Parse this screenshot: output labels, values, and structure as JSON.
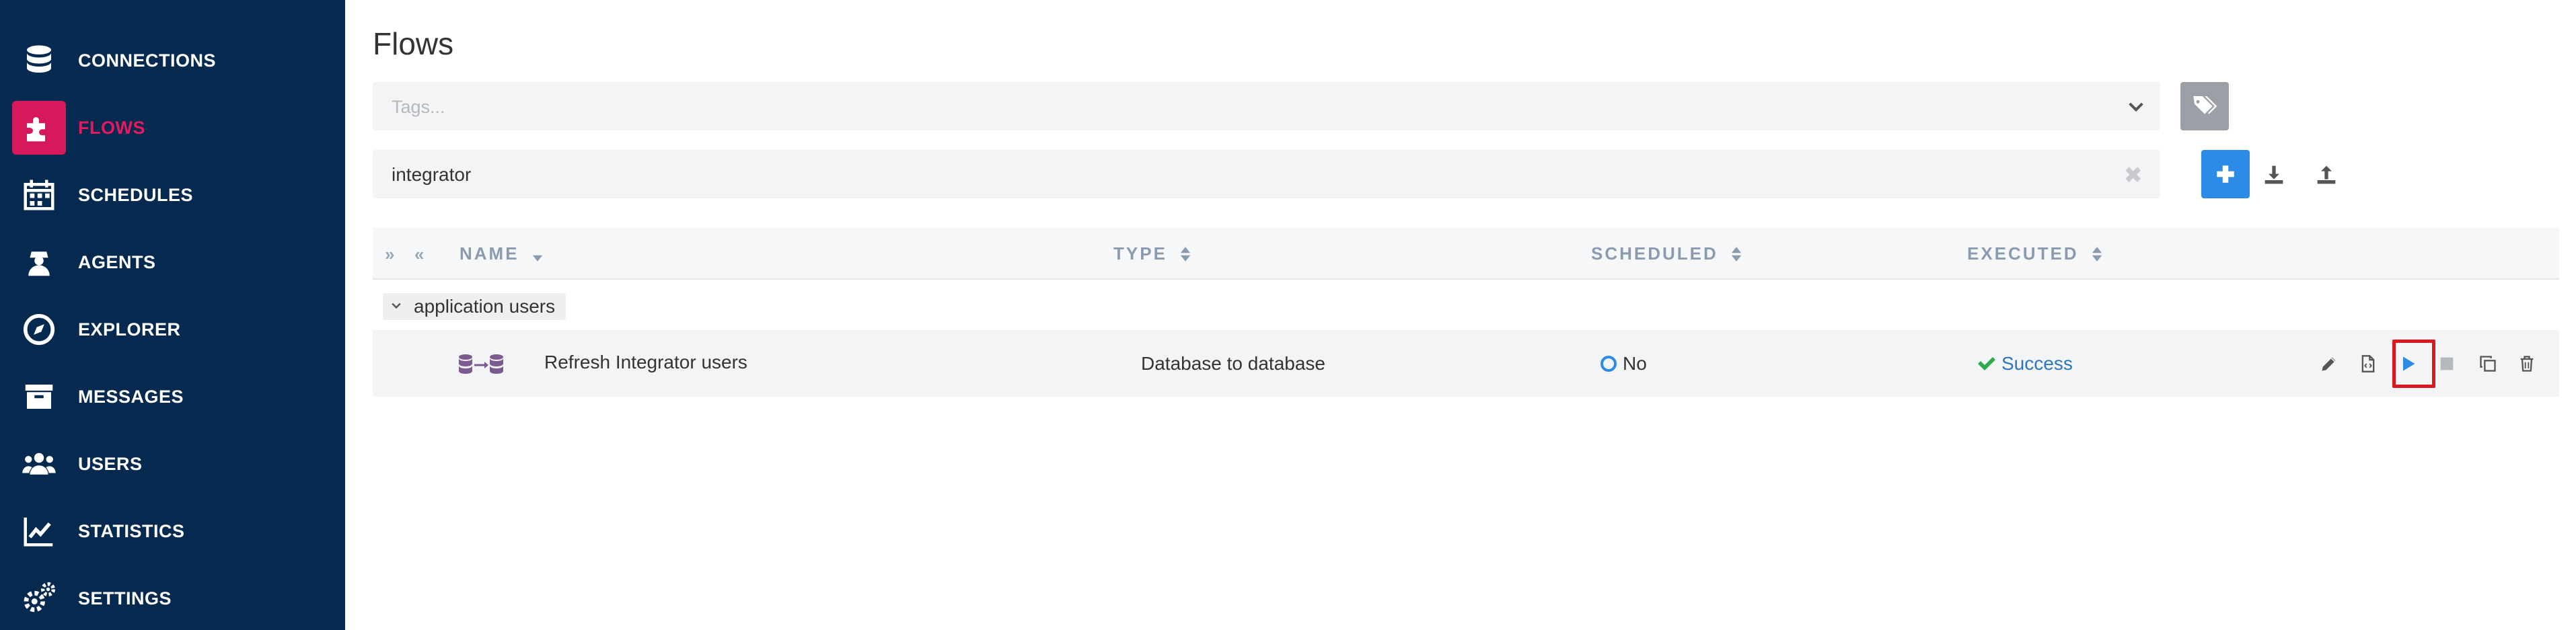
{
  "sidebar": {
    "items": [
      {
        "label": "CONNECTIONS",
        "icon": "database-icon",
        "active": false
      },
      {
        "label": "FLOWS",
        "icon": "puzzle-icon",
        "active": true
      },
      {
        "label": "SCHEDULES",
        "icon": "calendar-icon",
        "active": false
      },
      {
        "label": "AGENTS",
        "icon": "agent-icon",
        "active": false
      },
      {
        "label": "EXPLORER",
        "icon": "compass-icon",
        "active": false
      },
      {
        "label": "MESSAGES",
        "icon": "archive-box-icon",
        "active": false
      },
      {
        "label": "USERS",
        "icon": "users-icon",
        "active": false
      },
      {
        "label": "STATISTICS",
        "icon": "line-chart-icon",
        "active": false
      },
      {
        "label": "SETTINGS",
        "icon": "gears-icon",
        "active": false
      }
    ]
  },
  "main": {
    "title": "Flows",
    "tags_placeholder": "Tags...",
    "search_value": "integrator",
    "search_clear": "✖",
    "table": {
      "headers": {
        "name": "NAME",
        "type": "TYPE",
        "scheduled": "SCHEDULED",
        "executed": "EXECUTED"
      },
      "expand_all_icon": "»",
      "collapse_all_icon": "«",
      "group": {
        "label": "application users"
      },
      "rows": [
        {
          "name": "Refresh Integrator users",
          "type": "Database to database",
          "scheduled": "No",
          "executed": "Success"
        }
      ]
    }
  },
  "colors": {
    "sidebar_bg": "#062a4f",
    "active_accent": "#d6195c",
    "primary_blue": "#2c8be6",
    "success_green": "#2eaa4c",
    "highlight_red": "#d71920"
  }
}
